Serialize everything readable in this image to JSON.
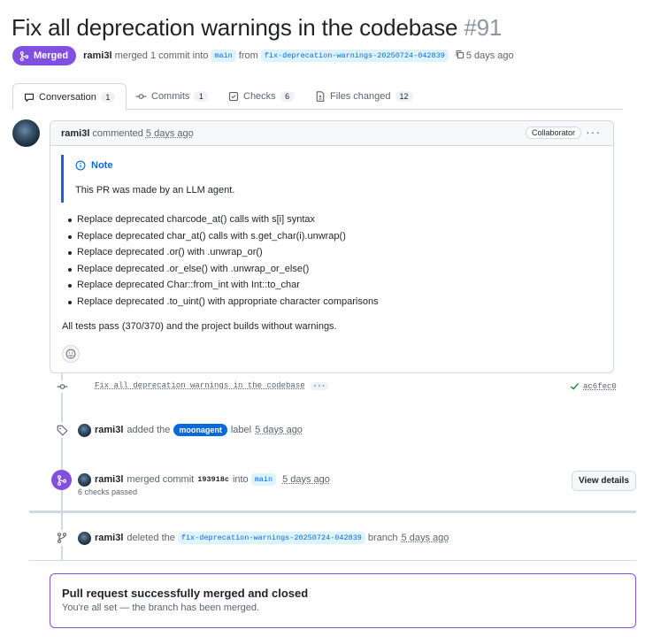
{
  "pr": {
    "title": "Fix all deprecation warnings in the codebase",
    "number": "#91",
    "state_label": "Merged",
    "author": "rami3l",
    "merged_phrase": "merged 1 commit into",
    "base_branch": "main",
    "from_word": "from",
    "head_branch": "fix-deprecation-warnings-20250724-042839",
    "age": "5 days ago"
  },
  "tabs": [
    {
      "label": "Conversation",
      "count": "1",
      "icon": "comment-icon"
    },
    {
      "label": "Commits",
      "count": "1",
      "icon": "commit-icon"
    },
    {
      "label": "Checks",
      "count": "6",
      "icon": "checks-icon"
    },
    {
      "label": "Files changed",
      "count": "12",
      "icon": "file-diff-icon"
    }
  ],
  "comment": {
    "author": "rami3l",
    "action": "commented",
    "time": "5 days ago",
    "role": "Collaborator",
    "more": "···",
    "note_title": "Note",
    "note_body": "This PR was made by an LLM agent.",
    "bullets": [
      "Replace deprecated charcode_at() calls with s[i] syntax",
      "Replace deprecated char_at() calls with s.get_char(i).unwrap()",
      "Replace deprecated .or() with .unwrap_or()",
      "Replace deprecated .or_else() with .unwrap_or_else()",
      "Replace deprecated Char::from_int with Int::to_char",
      "Replace deprecated .to_uint() with appropriate character comparisons"
    ],
    "summary": "All tests pass (370/370) and the project builds without warnings."
  },
  "timeline": {
    "commit": {
      "message": "Fix all deprecation warnings in the codebase",
      "ellipsis": "···",
      "sha": "ac6fec0"
    },
    "label_event": {
      "actor": "rami3l",
      "added_the": "added the",
      "label": "moonagent",
      "label_word": "label",
      "time": "5 days ago",
      "label_color": "#0969da"
    },
    "merge_event": {
      "actor": "rami3l",
      "merged_commit": "merged commit",
      "sha": "193918c",
      "into": "into",
      "branch": "main",
      "time": "5 days ago",
      "checks": "6 checks passed",
      "button": "View details"
    },
    "delete_event": {
      "actor": "rami3l",
      "deleted_the": "deleted the",
      "branch": "fix-deprecation-warnings-20250724-042839",
      "branch_word": "branch",
      "time": "5 days ago"
    }
  },
  "merged_box": {
    "title": "Pull request successfully merged and closed",
    "subtitle": "You're all set — the branch has been merged."
  },
  "colors": {
    "merged_purple": "#8250df",
    "link_blue": "#0969da",
    "success_green": "#1a7f37"
  }
}
